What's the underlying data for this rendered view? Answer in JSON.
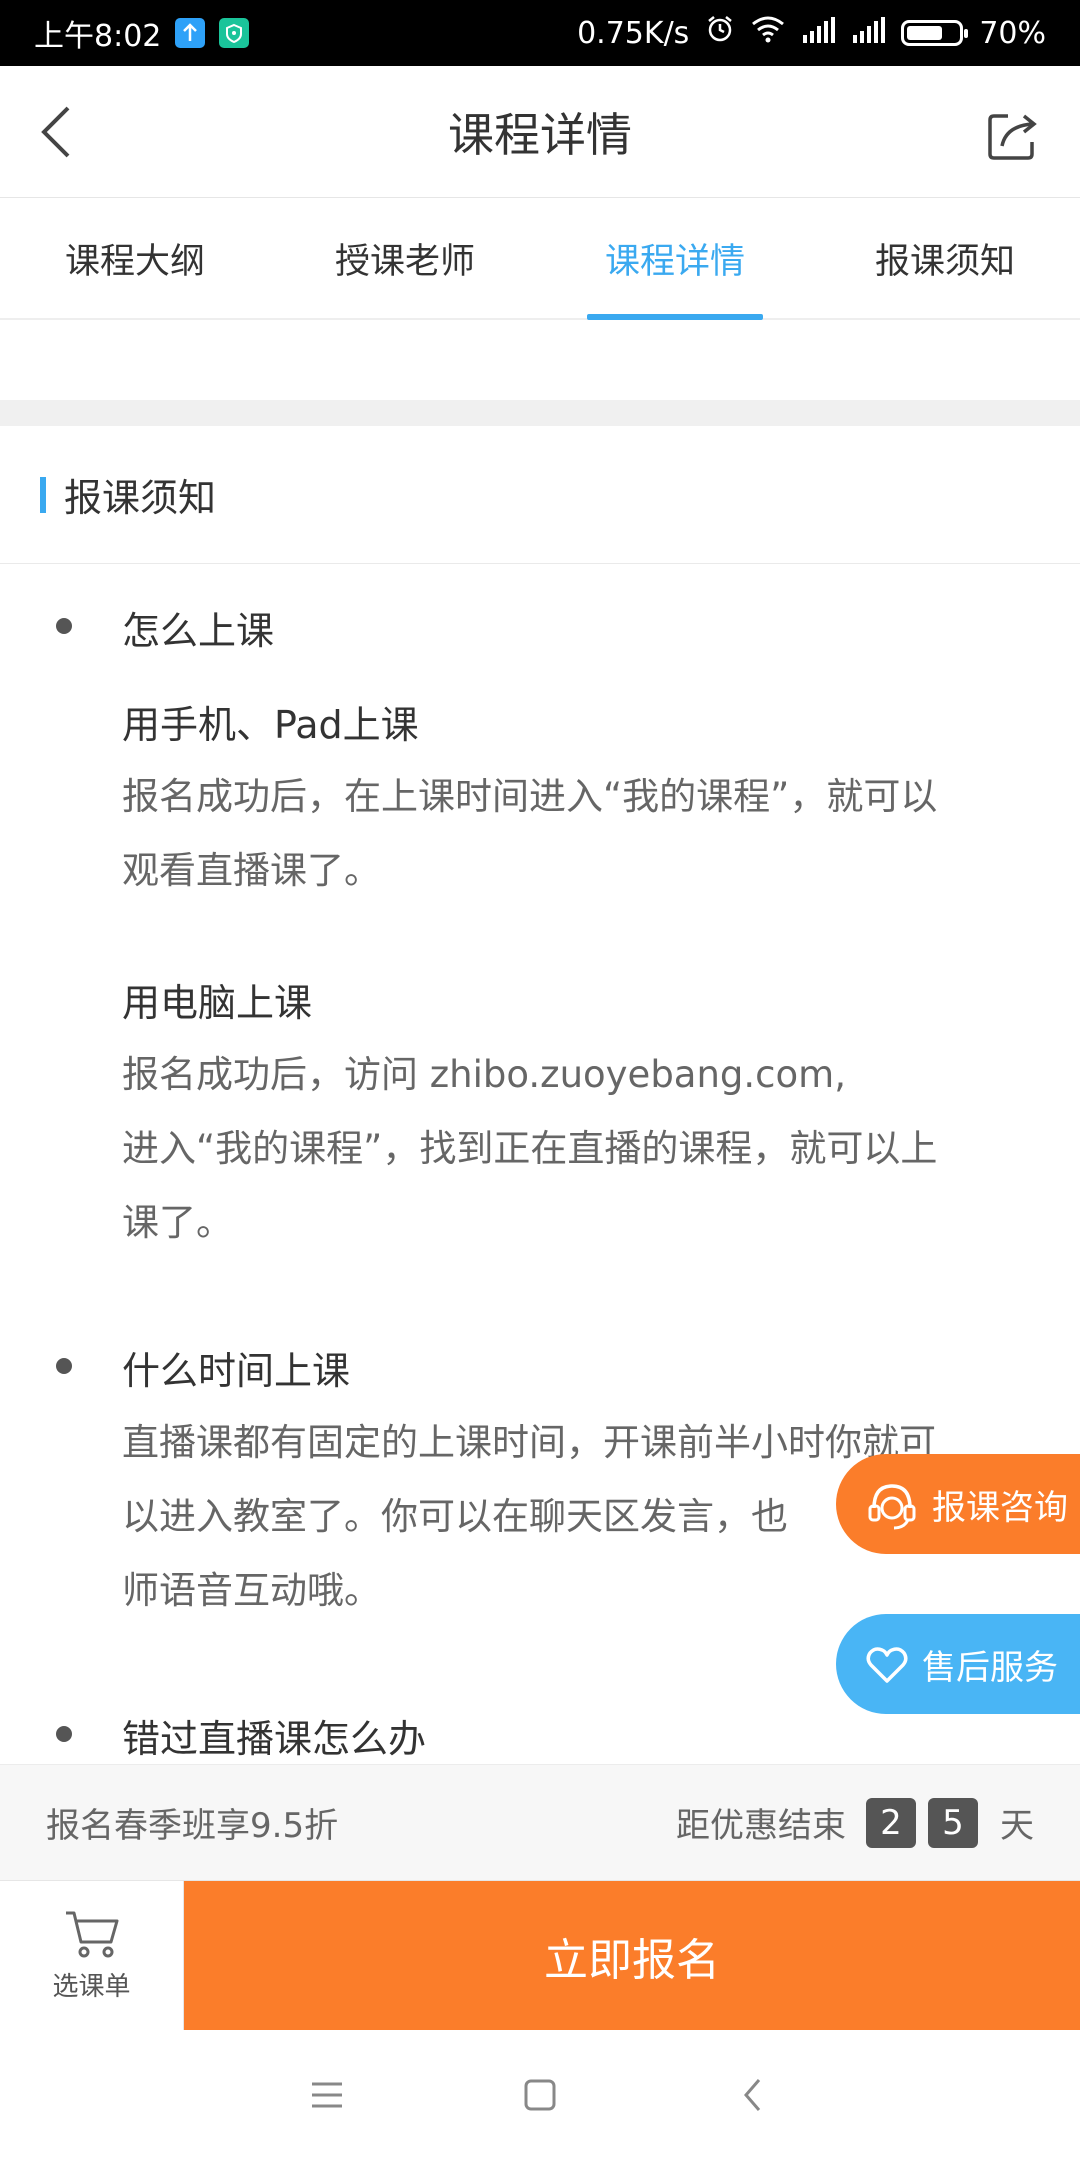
{
  "status_bar": {
    "time": "上午8:02",
    "network_speed": "0.75K/s",
    "battery": "70%",
    "battery_level": 0.7
  },
  "header": {
    "title": "课程详情"
  },
  "tabs": [
    {
      "label": "课程大纲",
      "active": false
    },
    {
      "label": "授课老师",
      "active": false
    },
    {
      "label": "课程详情",
      "active": true
    },
    {
      "label": "报课须知",
      "active": false
    }
  ],
  "section": {
    "title": "报课须知"
  },
  "content": {
    "items": [
      {
        "title": "怎么上课",
        "subsections": [
          {
            "subtitle": "用手机、Pad上课",
            "lines": [
              "报名成功后，在上课时间进入“我的课程”，就可以",
              "观看直播课了。"
            ]
          },
          {
            "subtitle": "用电脑上课",
            "lines": [
              "报名成功后，访问 zhibo.zuoyebang.com,",
              "进入“我的课程”，找到正在直播的课程，就可以上",
              "课了。"
            ]
          }
        ]
      },
      {
        "title": "什么时间上课",
        "lines": [
          "直播课都有固定的上课时间，开课前半小时你就可",
          "以进入教室了。你可以在聊天区发言，也",
          "师语音互动哦。"
        ]
      },
      {
        "title": "错过直播课怎么办"
      }
    ]
  },
  "float_buttons": {
    "consult": "报课咨询",
    "after_sales": "售后服务"
  },
  "promo": {
    "text": "报名春季班享9.5折",
    "countdown_label": "距优惠结束",
    "digit1": "2",
    "digit2": "5",
    "unit": "天"
  },
  "action": {
    "cart_label": "选课单",
    "enroll_label": "立即报名"
  },
  "colors": {
    "accent_blue": "#3aa9f0",
    "accent_orange": "#fb7d2a"
  }
}
